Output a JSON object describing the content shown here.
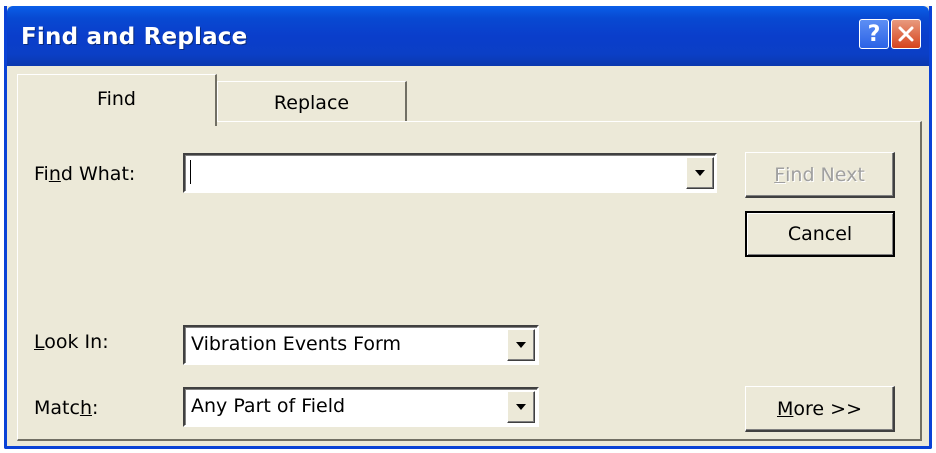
{
  "window": {
    "title": "Find and Replace",
    "help_glyph": "?",
    "close_icon": "close-x-icon"
  },
  "tabs": [
    {
      "label": "Find",
      "active": true
    },
    {
      "label": "Replace",
      "active": false
    }
  ],
  "find_what": {
    "label_pre": "Fi",
    "label_key": "n",
    "label_post": "d What:",
    "value": ""
  },
  "look_in": {
    "label_key": "L",
    "label_post": "ook In:",
    "value": "Vibration Events Form"
  },
  "match": {
    "label_pre": "Matc",
    "label_key": "h",
    "label_post": ":",
    "value": "Any Part of Field"
  },
  "buttons": {
    "find_next": {
      "key": "F",
      "rest": "ind Next",
      "disabled": true
    },
    "cancel": {
      "label": "Cancel"
    },
    "more": {
      "key": "M",
      "rest": "ore >>"
    }
  },
  "colors": {
    "titlebar": "#0a3ecb",
    "dialog_bg": "#ece9d8",
    "close_button": "#d6431d"
  }
}
